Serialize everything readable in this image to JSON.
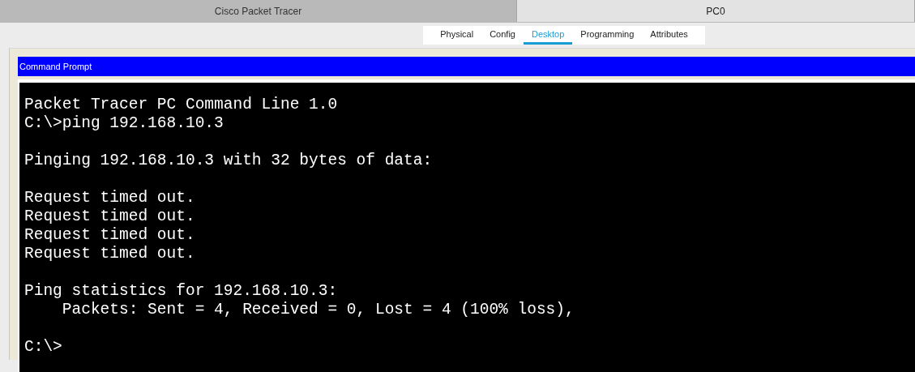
{
  "window_tabs": [
    {
      "label": "Cisco Packet Tracer",
      "selected": false
    },
    {
      "label": "PC0",
      "selected": true
    }
  ],
  "device_tabs": [
    {
      "label": "Physical",
      "selected": false
    },
    {
      "label": "Config",
      "selected": false
    },
    {
      "label": "Desktop",
      "selected": true
    },
    {
      "label": "Programming",
      "selected": false
    },
    {
      "label": "Attributes",
      "selected": false
    }
  ],
  "panel": {
    "title": "Command Prompt"
  },
  "terminal": {
    "blocks": [
      [
        "Packet Tracer PC Command Line 1.0",
        "C:\\>ping 192.168.10.3"
      ],
      [
        "Pinging 192.168.10.3 with 32 bytes of data:"
      ],
      [
        "Request timed out.",
        "Request timed out.",
        "Request timed out.",
        "Request timed out."
      ],
      [
        "Ping statistics for 192.168.10.3:",
        "    Packets: Sent = 4, Received = 0, Lost = 4 (100% loss),"
      ],
      [
        "C:\\>"
      ]
    ]
  }
}
